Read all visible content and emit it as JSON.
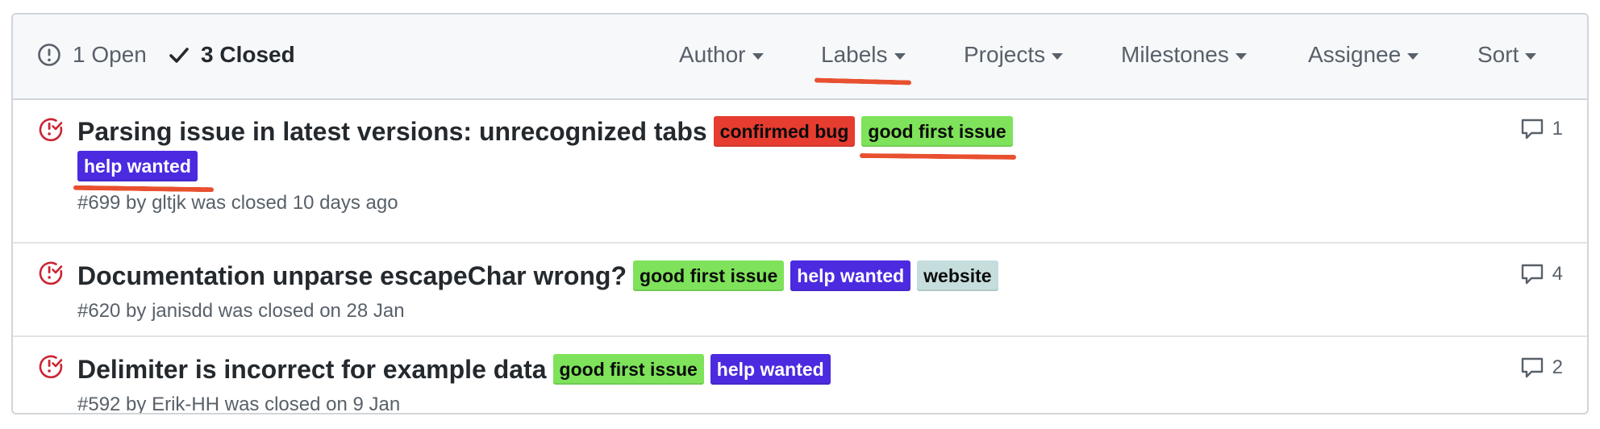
{
  "states": {
    "open_label": "1 Open",
    "closed_label": "3 Closed"
  },
  "filters": {
    "author": "Author",
    "labels": "Labels",
    "projects": "Projects",
    "milestones": "Milestones",
    "assignee": "Assignee",
    "sort": "Sort"
  },
  "issues": [
    {
      "title": "Parsing issue in latest versions: unrecognized tabs",
      "labels": [
        "confirmed bug",
        "good first issue",
        "help wanted"
      ],
      "meta": "#699 by gltjk was closed 10 days ago",
      "comments": "1"
    },
    {
      "title": "Documentation unparse escapeChar wrong?",
      "labels": [
        "good first issue",
        "help wanted",
        "website"
      ],
      "meta": "#620 by janisdd was closed on 28 Jan",
      "comments": "4"
    },
    {
      "title": "Delimiter is incorrect for example data",
      "labels": [
        "good first issue",
        "help wanted"
      ],
      "meta": "#592 by Erik-HH was closed on 9 Jan",
      "comments": "2"
    }
  ],
  "colors": {
    "confirmed_bug": "#e73c30",
    "good_first_issue": "#7ee35a",
    "help_wanted": "#4c2ae0",
    "website": "#c5dedd",
    "closed_icon": "#cb2431",
    "annotation": "#e8502f"
  },
  "icons": {
    "open": "issue-opened-icon",
    "closed": "check-icon",
    "issue_closed": "issue-closed-icon",
    "comment": "comment-icon"
  }
}
